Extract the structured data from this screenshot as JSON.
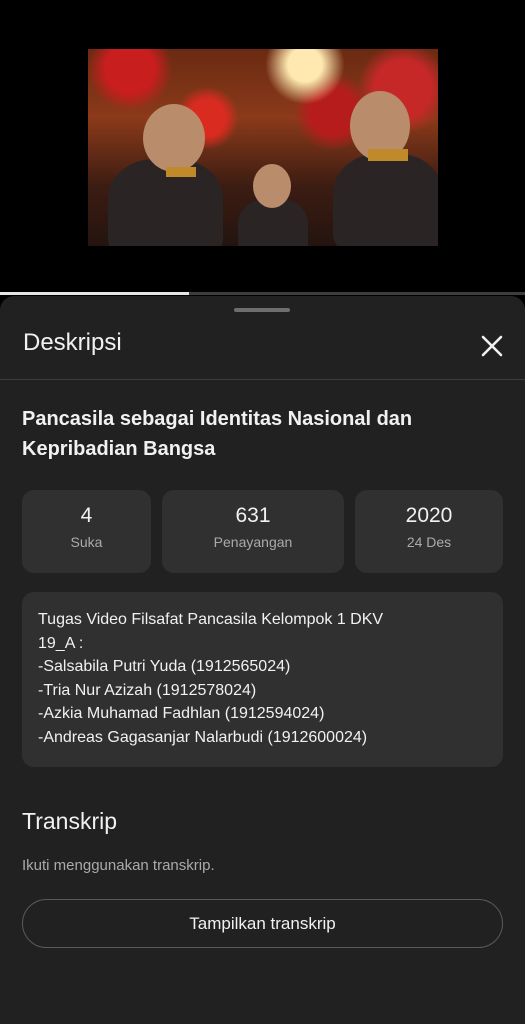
{
  "video": {
    "progress_fraction": 0.36
  },
  "sheet": {
    "title": "Deskripsi",
    "close_icon": "close-icon"
  },
  "details": {
    "title": "Pancasila sebagai Identitas Nasional dan Kepribadian Bangsa",
    "title_lines": [
      "Pancasila sebagai Identitas Nasional dan",
      "Kepribadian Bangsa"
    ],
    "stats": [
      {
        "value": "4",
        "label": "Suka"
      },
      {
        "value": "631",
        "label": "Penayangan"
      },
      {
        "value": "2020",
        "label": "24 Des"
      }
    ],
    "description_lines": [
      "Tugas Video Filsafat Pancasila Kelompok 1 DKV",
      "19_A :",
      "-Salsabila Putri Yuda (1912565024)",
      "-Tria Nur Azizah (1912578024)",
      "-Azkia Muhamad Fadhlan (1912594024)",
      "-Andreas Gagasanjar Nalarbudi (1912600024)"
    ]
  },
  "transcript": {
    "title": "Transkrip",
    "subtitle": "Ikuti menggunakan transkrip.",
    "button_label": "Tampilkan transkrip"
  },
  "colors": {
    "background": "#212121",
    "card": "#303030",
    "text": "#f1f1f1",
    "muted": "#aaaaaa"
  }
}
